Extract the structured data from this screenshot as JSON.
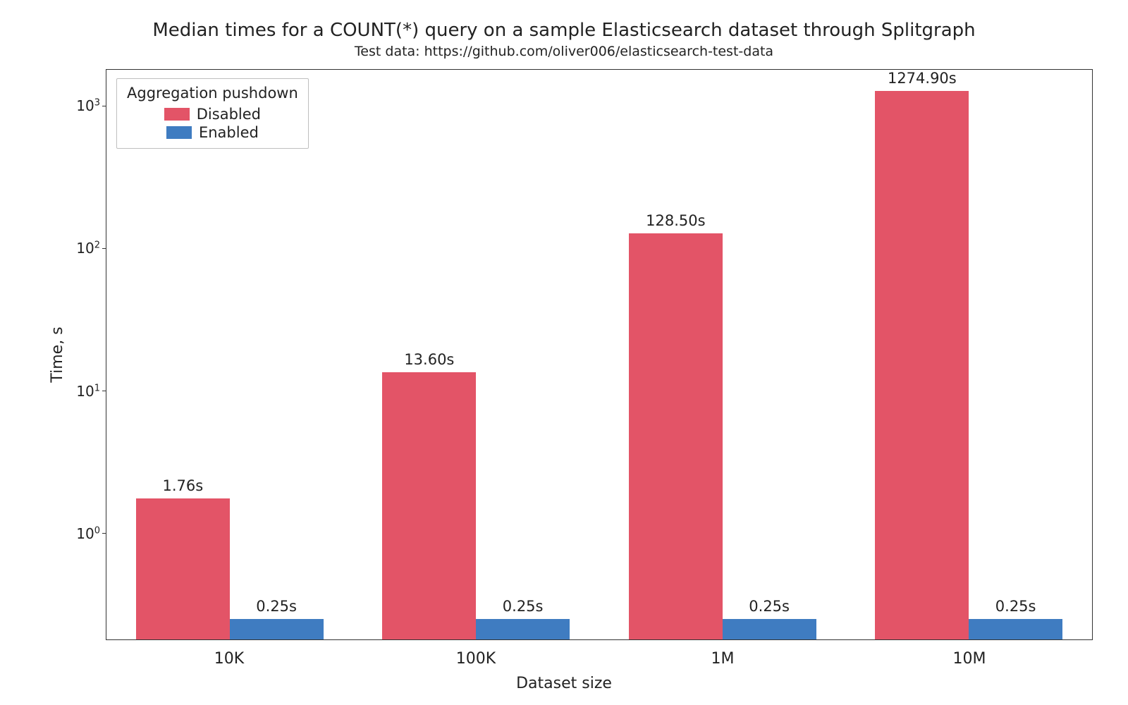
{
  "chart_data": {
    "type": "bar",
    "title": "Median times for a COUNT(*) query on a sample Elasticsearch dataset through Splitgraph",
    "subtitle": "Test data: https://github.com/oliver006/elasticsearch-test-data",
    "xlabel": "Dataset size",
    "ylabel": "Time, s",
    "yscale": "log",
    "ylim": [
      0.18,
      1800
    ],
    "yticks": [
      1,
      10,
      100,
      1000
    ],
    "ytick_labels": [
      "10⁰",
      "10¹",
      "10²",
      "10³"
    ],
    "categories": [
      "10K",
      "100K",
      "1M",
      "10M"
    ],
    "legend_title": "Aggregation pushdown",
    "legend_position": "upper left",
    "series": [
      {
        "name": "Disabled",
        "color": "#e35467",
        "values": [
          1.76,
          13.6,
          128.5,
          1274.9
        ],
        "labels": [
          "1.76s",
          "13.60s",
          "128.50s",
          "1274.90s"
        ]
      },
      {
        "name": "Enabled",
        "color": "#3f7cc1",
        "values": [
          0.25,
          0.25,
          0.25,
          0.25
        ],
        "labels": [
          "0.25s",
          "0.25s",
          "0.25s",
          "0.25s"
        ]
      }
    ],
    "grid": false,
    "bar_width_fraction": 0.38
  }
}
